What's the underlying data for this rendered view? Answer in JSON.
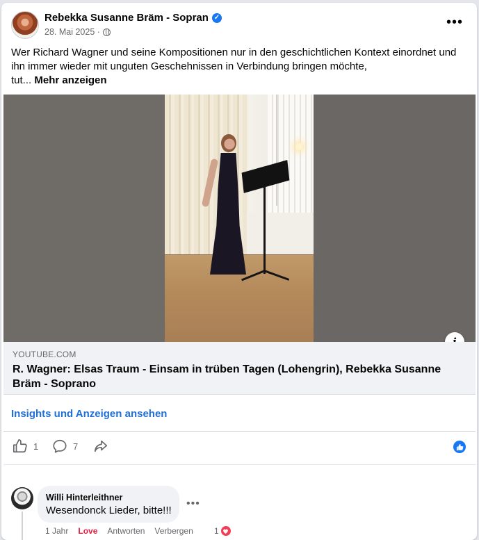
{
  "post": {
    "author": "Rebekka Susanne Bräm - Sopran",
    "date": "28. Mai 2025 ·",
    "text_line1": "Wer Richard Wagner und seine Kompositionen nur in den geschichtlichen Kontext einordnet und",
    "text_line2": "ihn immer wieder mit unguten Geschehnissen in Verbindung bringen möchte,",
    "text_line3": "tut...",
    "see_more": "Mehr anzeigen",
    "more_options": "•••"
  },
  "link_preview": {
    "domain": "YOUTUBE.COM",
    "title": "R. Wagner: Elsas Traum - Einsam in trüben Tagen (Lohengrin), Rebekka Susanne Bräm - Soprano",
    "info_icon": "i"
  },
  "insights": {
    "label": "Insights und Anzeigen ansehen"
  },
  "actions": {
    "like_count": "1",
    "comment_count": "7"
  },
  "comment": {
    "author": "Willi Hinterleithner",
    "text": "Wesendonck Lieder, bitte!!!",
    "more": "•••",
    "time": "1 Jahr",
    "reaction_label": "Love",
    "reply_label": "Antworten",
    "hide_label": "Verbergen",
    "reaction_count": "1"
  },
  "colors": {
    "link_blue": "#216fdb",
    "brand_blue": "#1877f2",
    "love_red": "#e41e3f"
  }
}
